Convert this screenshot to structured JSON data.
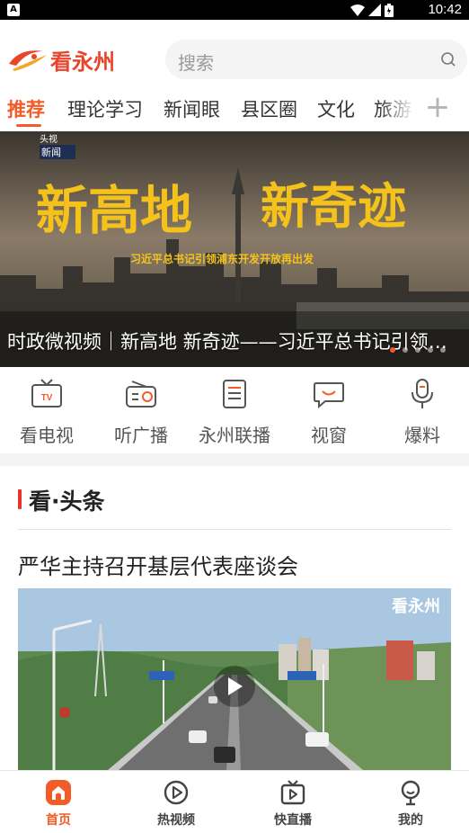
{
  "status_bar": {
    "left_icon": "A",
    "time": "10:42",
    "icons": [
      "wifi-icon",
      "signal-icon",
      "battery-icon"
    ]
  },
  "header": {
    "logo_text": "看永州",
    "search_placeholder": "搜索"
  },
  "tabs": [
    {
      "label": "推荐",
      "active": true
    },
    {
      "label": "理论学习"
    },
    {
      "label": "新闻眼"
    },
    {
      "label": "县区圈"
    },
    {
      "label": "文化"
    },
    {
      "label": "旅游"
    }
  ],
  "tabs_more_icon": "plus-icon",
  "banner": {
    "badge_top": "头视",
    "badge_bottom": "新闻",
    "headline_overlay_1": "新高地",
    "headline_overlay_2": "新奇迹",
    "subtitle_overlay": "习近平总书记引领浦东开发开放再出发",
    "caption": "时政微视频｜新高地 新奇迹——习近平总书记引领浦东开发开放再出发",
    "slide_count": 5,
    "active_slide": 1
  },
  "quick_menu": [
    {
      "label": "看电视",
      "icon": "tv-icon"
    },
    {
      "label": "听广播",
      "icon": "radio-icon"
    },
    {
      "label": "永州联播",
      "icon": "document-icon"
    },
    {
      "label": "视窗",
      "icon": "chat-bubble-icon"
    },
    {
      "label": "爆料",
      "icon": "microphone-icon"
    }
  ],
  "headline_section": {
    "title": "看·头条",
    "article_title": "严华主持召开基层代表座谈会",
    "video_logo": "看永州"
  },
  "bottom_nav": [
    {
      "label": "首页",
      "icon": "home-icon",
      "active": true
    },
    {
      "label": "热视频",
      "icon": "play-circle-icon"
    },
    {
      "label": "快直播",
      "icon": "live-tv-icon"
    },
    {
      "label": "我的",
      "icon": "profile-icon"
    }
  ],
  "colors": {
    "accent": "#f25c26",
    "brand_red": "#e8452b",
    "section_bar": "#e8332a",
    "icon_stroke": "#555555"
  }
}
